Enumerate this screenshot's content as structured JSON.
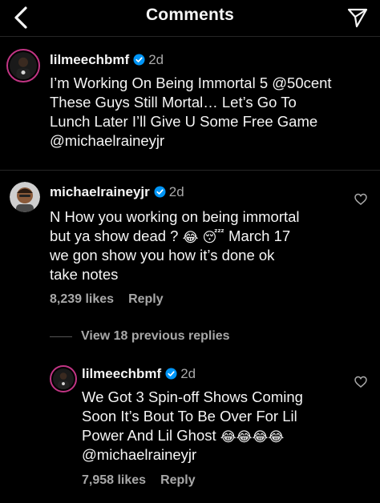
{
  "header": {
    "title": "Comments"
  },
  "caption": {
    "username": "lilmeechbmf",
    "time": "2d",
    "lines": [
      "I’m Working On Being Immortal 5 @50cent",
      "These Guys Still Mortal… Let’s Go To",
      "Lunch Later I’ll Give U Some Free Game",
      "@michaelraineyjr"
    ]
  },
  "comment": {
    "username": "michaelraineyjr",
    "time": "2d",
    "line1": "N How you working on being immortal",
    "line2_text": "but ya show dead ?",
    "line2_tail": "March 17",
    "line3": "we gon show you how it’s done ok",
    "line4": "take notes",
    "likes": "8,239 likes",
    "reply": "Reply"
  },
  "view_replies": "View 18 previous replies",
  "reply_comment": {
    "username": "lilmeechbmf",
    "time": "2d",
    "line1": "We Got 3 Spin-off Shows Coming",
    "line2": "Soon It’s Bout To Be Over For Lil",
    "line3_text": "Power And Lil Ghost",
    "line4": "@michaelraineyjr",
    "likes": "7,958 likes",
    "reply": "Reply"
  },
  "colors": {
    "background": "#000000",
    "text": "#f5f5f5",
    "muted": "#a8a8a8",
    "verified": "#0095f6"
  },
  "icons": [
    "back-chevron-icon",
    "send-icon",
    "verified-badge-icon",
    "heart-icon",
    "laughing-emoji-icon",
    "sleepy-emoji-icon"
  ]
}
